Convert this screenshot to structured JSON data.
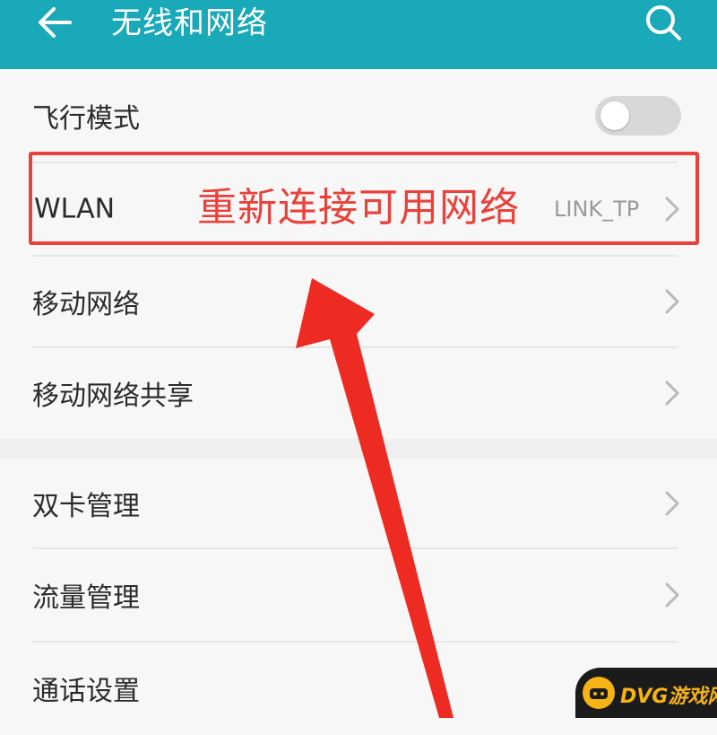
{
  "header": {
    "title": "无线和网络",
    "back_icon": "arrow-left-icon",
    "search_icon": "search-icon",
    "background_color": "#1aa9b8"
  },
  "settings": {
    "airplane_mode": {
      "label": "飞行模式",
      "toggle_on": false
    },
    "wlan": {
      "label": "WLAN",
      "value": "LINK_TP"
    },
    "mobile_network": {
      "label": "移动网络"
    },
    "tethering": {
      "label": "移动网络共享"
    },
    "dual_sim": {
      "label": "双卡管理"
    },
    "data_usage": {
      "label": "流量管理"
    },
    "call_settings": {
      "label": "通话设置"
    }
  },
  "annotation": {
    "text": "重新连接可用网络",
    "color": "#e8423b"
  },
  "watermark": {
    "text": "DVG游戏网",
    "color": "#f5b315"
  }
}
